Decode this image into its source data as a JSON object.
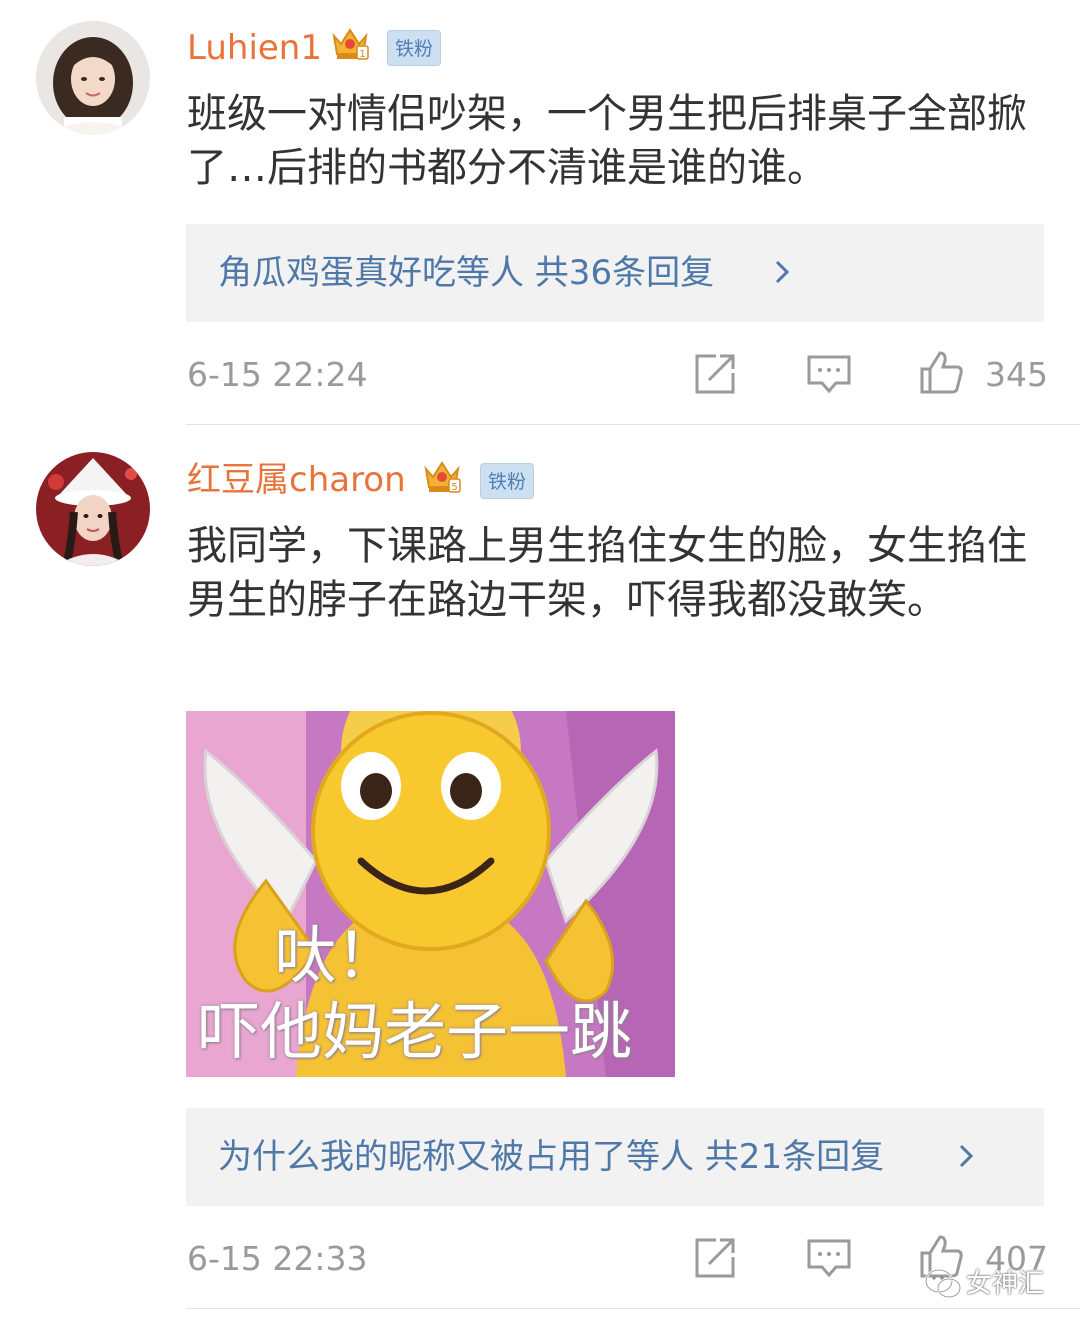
{
  "comments": [
    {
      "username": "Luhien1",
      "badge": "铁粉",
      "text": "班级一对情侣吵架，一个男生把后排桌子全部掀了…后排的书都分不清谁是谁的谁。",
      "replies": "角瓜鸡蛋真好吃等人  共36条回复",
      "time": "6-15 22:24",
      "likes": "345",
      "crown_level": "1"
    },
    {
      "username": "红豆属charon",
      "badge": "铁粉",
      "text": "我同学，下课路上男生掐住女生的脸，女生掐住男生的脖子在路边干架，吓得我都没敢笑。",
      "replies": "为什么我的昵称又被占用了等人  共21条回复",
      "time": "6-15 22:33",
      "likes": "407",
      "crown_level": "5",
      "sticker": {
        "line1": "呔！",
        "line2": "吓他妈老子一跳"
      }
    }
  ],
  "watermark": "女神汇",
  "colors": {
    "username": "#e8743b",
    "reply_link": "#4f78a8",
    "meta": "#9a9a9a",
    "reply_bg": "#f2f2f2",
    "badge_bg": "#cde0f2"
  }
}
